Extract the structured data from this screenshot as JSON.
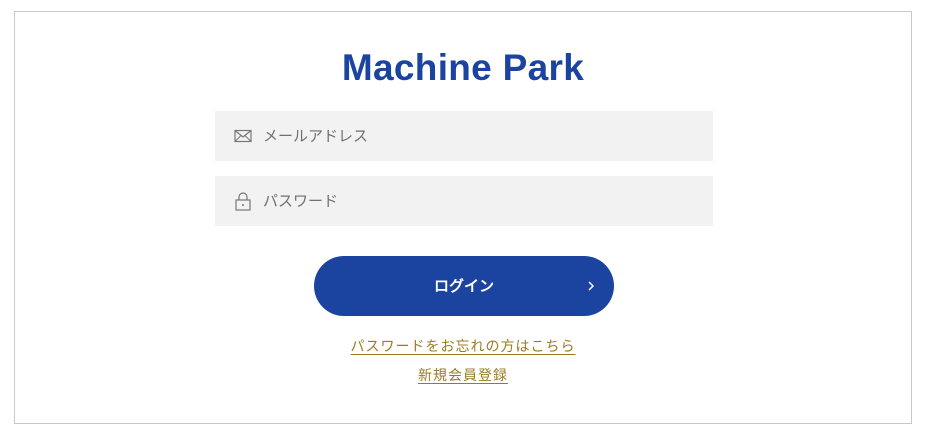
{
  "app": {
    "title": "Machine Park"
  },
  "form": {
    "email": {
      "placeholder": "メールアドレス",
      "value": "",
      "icon": "envelope-icon"
    },
    "password": {
      "placeholder": "パスワード",
      "value": "",
      "icon": "lock-icon"
    },
    "login_button": {
      "label": "ログイン",
      "icon": "chevron-right-icon"
    }
  },
  "links": {
    "forgot_password": "パスワードをお忘れの方はこちら",
    "register": "新規会員登録"
  },
  "colors": {
    "brand": "#1b43a0",
    "link": "#9a7b25",
    "field_background": "#f2f2f2",
    "border": "#c8c8c8"
  }
}
